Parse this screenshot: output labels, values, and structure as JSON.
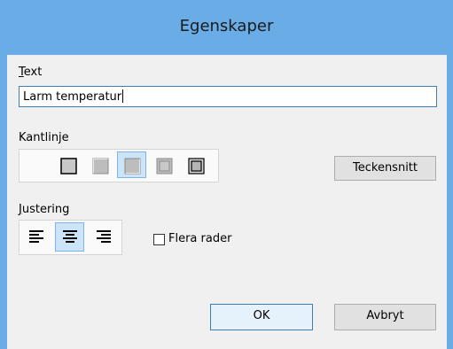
{
  "window": {
    "title": "Egenskaper"
  },
  "text_section": {
    "label": "Text",
    "value": "Larm temperatur"
  },
  "border_section": {
    "label": "Kantlinje",
    "options": [
      "no-border-icon",
      "single-border-icon",
      "raised-border-icon",
      "sunken-border-icon",
      "etched-border-icon",
      "double-border-icon"
    ],
    "selected_index": 3
  },
  "font_button": {
    "label": "Teckensnitt"
  },
  "align_section": {
    "label": "Justering",
    "options": [
      "align-left-icon",
      "align-center-icon",
      "align-right-icon"
    ],
    "selected_index": 1
  },
  "multiline": {
    "label": "Flera rader",
    "checked": false
  },
  "buttons": {
    "ok": "OK",
    "cancel": "Avbryt"
  }
}
